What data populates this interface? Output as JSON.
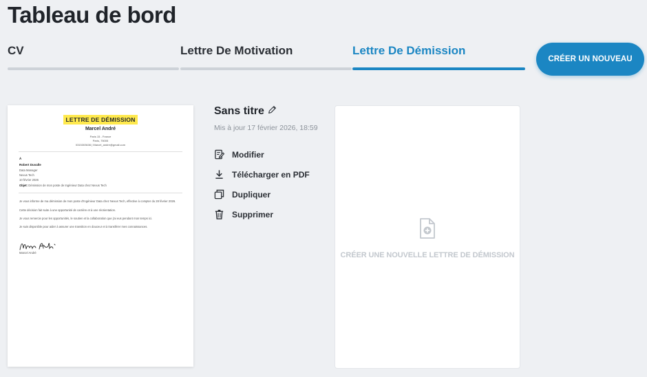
{
  "page": {
    "title": "Tableau de bord"
  },
  "tabs": [
    {
      "label": "CV",
      "active": false
    },
    {
      "label": "Lettre De Motivation",
      "active": false
    },
    {
      "label": "Lettre De Démission",
      "active": true
    }
  ],
  "create_button": {
    "label": "CRÉER UN NOUVEAU"
  },
  "document": {
    "preview": {
      "heading": "LETTRE DE DÉMISSION",
      "sender_name": "Marcel André",
      "sender_lines": [
        "Paris 15 - France",
        "Paris, 75005",
        "0315303636 | Marcel_andre@gmail.com"
      ],
      "recipient_prefix": "À",
      "recipient_name": "Robert Duvalle",
      "recipient_lines": [
        "Data Manager",
        "Nexus Tech",
        "10 février 2026"
      ],
      "subject_label": "Objet:",
      "subject_text": "Démission de mon poste de Ingénieur Data chez Nexus Tech",
      "body": [
        "Je vous informe de ma démission de mon poste d'Ingénieur Data chez Nexus Tech, effective à compter du 28 février 2026.",
        "Cette décision fait suite à une opportunité de carrière et à une réorientation.",
        "Je vous remercie pour les opportunités, le soutien et la collaboration que j'ai eus pendant mon temps ici.",
        "Je suis disponible pour aider à assurer une transition en douceur et à transférer mes connaissances."
      ],
      "signature_name": "Marcel André"
    },
    "title": "Sans titre",
    "updated": "Mis à jour 17 février 2026, 18:59",
    "actions": [
      {
        "label": "Modifier",
        "icon": "edit-icon"
      },
      {
        "label": "Télécharger en PDF",
        "icon": "download-icon"
      },
      {
        "label": "Dupliquer",
        "icon": "duplicate-icon"
      },
      {
        "label": "Supprimer",
        "icon": "trash-icon"
      }
    ]
  },
  "new_card": {
    "label": "CRÉER UNE NOUVELLE LETTRE DE DÉMISSION",
    "icon": "add-document-icon"
  },
  "colors": {
    "accent": "#1b86c3",
    "highlight": "#ffe94d",
    "background": "#eef0f3"
  }
}
